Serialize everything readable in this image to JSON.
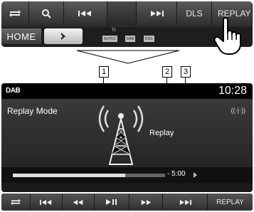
{
  "top_bar": {
    "dls_label": "DLS",
    "replay_label": "REPLAY",
    "home_label": "HOME",
    "ti_label": "TI",
    "indicators": [
      "AUTO1",
      "DAB",
      "RDS"
    ]
  },
  "callouts": [
    "1",
    "2",
    "3"
  ],
  "screen": {
    "source": "DAB",
    "clock": "10:28",
    "mode_label": "Replay Mode",
    "replay_text": "Replay",
    "time": "- 5:00",
    "progress": 0.74
  },
  "bottom_bar": {
    "replay_label": "REPLAY"
  },
  "icons": [
    "swap-icon",
    "search-icon",
    "skip-back-icon",
    "skip-forward-icon",
    "chevron-right-icon",
    "hand-pointer-icon",
    "tower-icon",
    "antenna-signal-icon",
    "rewind-icon",
    "play-pause-icon",
    "fast-forward-icon"
  ]
}
